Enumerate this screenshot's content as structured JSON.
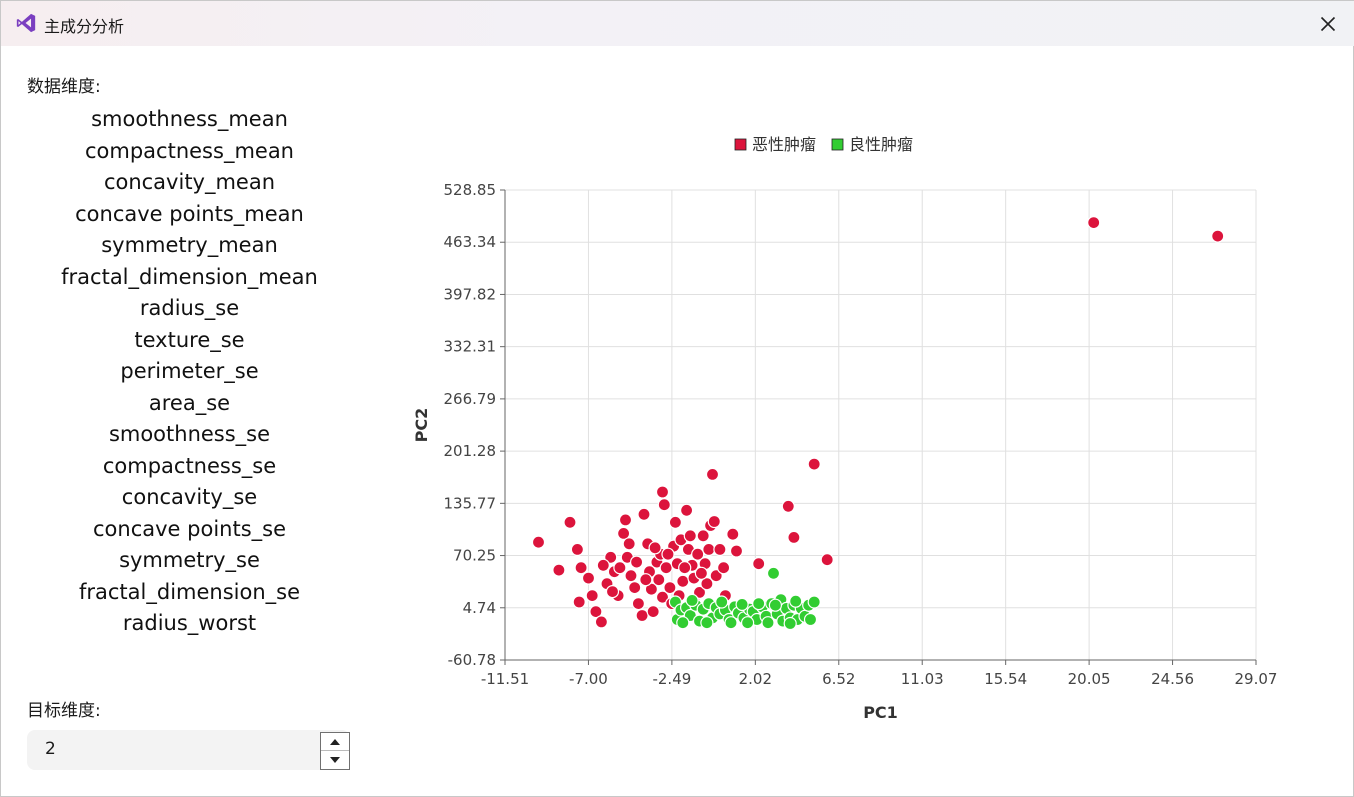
{
  "window": {
    "title": "主成分分析",
    "app_icon": "visual-studio-icon",
    "close_icon": "close-icon"
  },
  "panel": {
    "dims_label": "数据维度:",
    "dims": [
      "smoothness_mean",
      "compactness_mean",
      "concavity_mean",
      "concave points_mean",
      "symmetry_mean",
      "fractal_dimension_mean",
      "radius_se",
      "texture_se",
      "perimeter_se",
      "area_se",
      "smoothness_se",
      "compactness_se",
      "concavity_se",
      "concave points_se",
      "symmetry_se",
      "fractal_dimension_se",
      "radius_worst"
    ],
    "target_label": "目标维度:",
    "target_value": "2"
  },
  "colors": {
    "malignant": "#dc143c",
    "benign": "#32cd32",
    "grid": "#e0e0e0",
    "axis_text": "#444444"
  },
  "chart_data": {
    "type": "scatter",
    "xlabel": "PC1",
    "ylabel": "PC2",
    "xlim": [
      -11.51,
      29.07
    ],
    "ylim": [
      -60.78,
      528.85
    ],
    "xticks": [
      "-11.51",
      "-7.00",
      "-2.49",
      "2.02",
      "6.52",
      "11.03",
      "15.54",
      "20.05",
      "24.56",
      "29.07"
    ],
    "yticks": [
      "-60.78",
      "4.74",
      "70.25",
      "135.77",
      "201.28",
      "266.79",
      "332.31",
      "397.82",
      "463.34",
      "528.85"
    ],
    "grid": true,
    "legend": "top",
    "series": [
      {
        "name": "恶性肿瘤",
        "color": "#dc143c",
        "points": [
          [
            -9.7,
            87
          ],
          [
            -8.6,
            52
          ],
          [
            -8.0,
            112
          ],
          [
            -7.6,
            78
          ],
          [
            -7.4,
            55
          ],
          [
            -7.5,
            12
          ],
          [
            -7.0,
            42
          ],
          [
            -6.8,
            20
          ],
          [
            -6.6,
            0
          ],
          [
            -6.3,
            -13
          ],
          [
            -6.0,
            35
          ],
          [
            -5.8,
            68
          ],
          [
            -5.6,
            50
          ],
          [
            -5.4,
            20
          ],
          [
            -5.1,
            98
          ],
          [
            -5.0,
            115
          ],
          [
            -4.9,
            68
          ],
          [
            -4.7,
            45
          ],
          [
            -4.5,
            30
          ],
          [
            -4.3,
            10
          ],
          [
            -4.1,
            -5
          ],
          [
            -4.0,
            122
          ],
          [
            -3.8,
            85
          ],
          [
            -3.7,
            50
          ],
          [
            -3.6,
            28
          ],
          [
            -3.5,
            0
          ],
          [
            -3.3,
            62
          ],
          [
            -3.2,
            40
          ],
          [
            -3.0,
            18
          ],
          [
            -3.0,
            150
          ],
          [
            -2.9,
            134
          ],
          [
            -2.8,
            55
          ],
          [
            -2.6,
            30
          ],
          [
            -2.5,
            10
          ],
          [
            -2.4,
            82
          ],
          [
            -2.3,
            112
          ],
          [
            -2.2,
            60
          ],
          [
            -2.0,
            90
          ],
          [
            -1.9,
            38
          ],
          [
            -1.7,
            127
          ],
          [
            -1.6,
            78
          ],
          [
            -1.5,
            95
          ],
          [
            -1.4,
            58
          ],
          [
            -1.3,
            42
          ],
          [
            -1.1,
            72
          ],
          [
            -1.0,
            24
          ],
          [
            -0.8,
            95
          ],
          [
            -0.7,
            60
          ],
          [
            -0.5,
            78
          ],
          [
            -0.4,
            108
          ],
          [
            -0.3,
            172
          ],
          [
            -0.2,
            113
          ],
          [
            -0.1,
            45
          ],
          [
            0.1,
            78
          ],
          [
            0.4,
            20
          ],
          [
            0.8,
            97
          ],
          [
            1.0,
            76
          ],
          [
            2.2,
            60
          ],
          [
            3.8,
            132
          ],
          [
            4.1,
            93
          ],
          [
            5.2,
            185
          ],
          [
            5.9,
            65
          ],
          [
            -5.3,
            55
          ],
          [
            -4.8,
            85
          ],
          [
            -3.9,
            40
          ],
          [
            -3.1,
            72
          ],
          [
            -2.1,
            20
          ],
          [
            -1.2,
            10
          ],
          [
            -0.6,
            35
          ],
          [
            -6.2,
            58
          ],
          [
            -5.7,
            25
          ],
          [
            -4.4,
            62
          ],
          [
            -3.4,
            80
          ],
          [
            -2.7,
            72
          ],
          [
            -1.8,
            55
          ],
          [
            -0.9,
            48
          ],
          [
            0.3,
            55
          ],
          [
            20.3,
            488
          ],
          [
            27.0,
            471
          ]
        ]
      },
      {
        "name": "良性肿瘤",
        "color": "#32cd32",
        "points": [
          [
            -2.3,
            12
          ],
          [
            -2.2,
            -10
          ],
          [
            -2.0,
            2
          ],
          [
            -1.7,
            5
          ],
          [
            -1.5,
            -5
          ],
          [
            -1.2,
            8
          ],
          [
            -1.0,
            -12
          ],
          [
            -0.8,
            3
          ],
          [
            -0.5,
            10
          ],
          [
            -0.3,
            -8
          ],
          [
            -0.1,
            5
          ],
          [
            0.1,
            -3
          ],
          [
            0.4,
            2
          ],
          [
            0.6,
            -10
          ],
          [
            0.9,
            6
          ],
          [
            1.1,
            -2
          ],
          [
            1.4,
            -8
          ],
          [
            1.7,
            3
          ],
          [
            1.9,
            0
          ],
          [
            2.1,
            -10
          ],
          [
            2.4,
            6
          ],
          [
            2.6,
            -6
          ],
          [
            2.9,
            10
          ],
          [
            3.0,
            48
          ],
          [
            3.2,
            -3
          ],
          [
            3.4,
            15
          ],
          [
            3.5,
            -12
          ],
          [
            3.7,
            4
          ],
          [
            3.9,
            -8
          ],
          [
            4.1,
            8
          ],
          [
            4.3,
            -10
          ],
          [
            4.5,
            4
          ],
          [
            4.7,
            -6
          ],
          [
            4.9,
            8
          ],
          [
            5.0,
            -10
          ],
          [
            5.2,
            12
          ],
          [
            -1.9,
            -14
          ],
          [
            -0.6,
            -14
          ],
          [
            0.7,
            -14
          ],
          [
            1.6,
            -14
          ],
          [
            2.7,
            -14
          ],
          [
            3.9,
            -15
          ],
          [
            -1.4,
            14
          ],
          [
            0.2,
            12
          ],
          [
            1.3,
            9
          ],
          [
            2.2,
            10
          ],
          [
            3.1,
            8
          ],
          [
            4.2,
            13
          ]
        ]
      }
    ]
  }
}
